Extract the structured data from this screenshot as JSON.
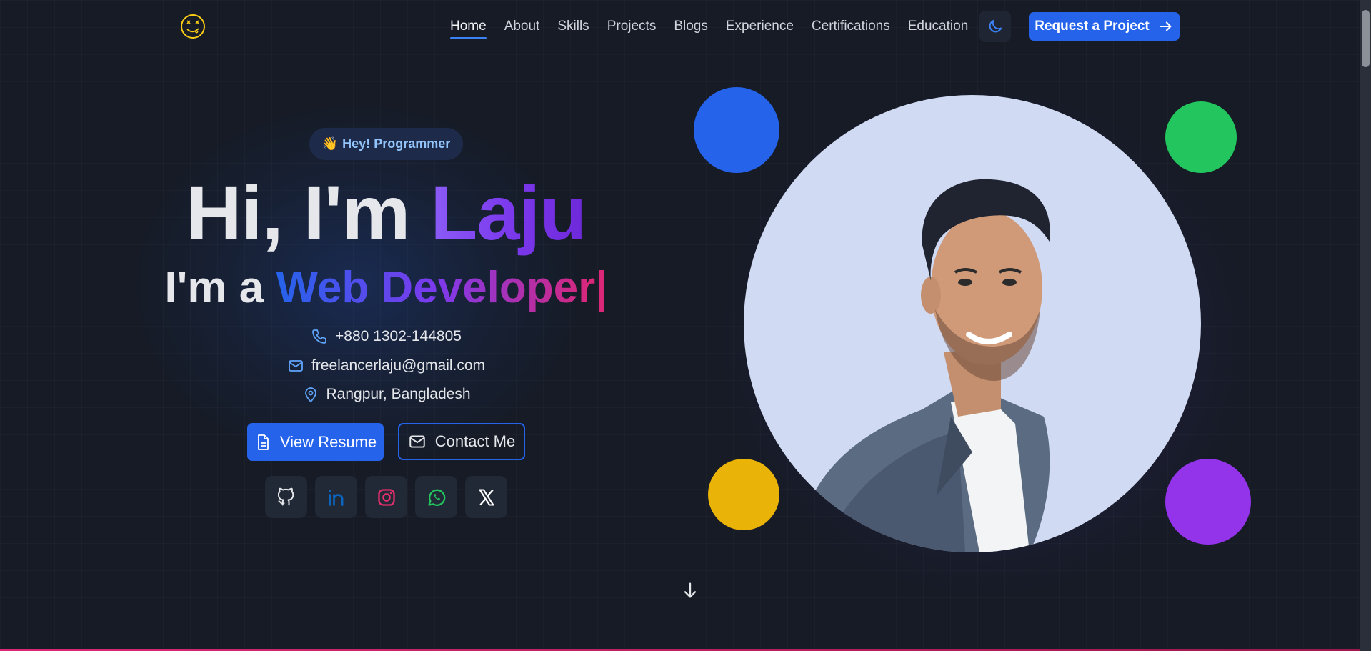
{
  "nav": {
    "logo_icon": "smiley-face-logo-icon",
    "items": [
      {
        "label": "Home",
        "active": true
      },
      {
        "label": "About"
      },
      {
        "label": "Skills"
      },
      {
        "label": "Projects"
      },
      {
        "label": "Blogs"
      },
      {
        "label": "Experience"
      },
      {
        "label": "Certifications"
      },
      {
        "label": "Education"
      }
    ],
    "theme_toggle_icon": "moon-icon",
    "cta_label": "Request a Project",
    "cta_icon": "arrow-right-icon"
  },
  "hero": {
    "badge_emoji": "👋",
    "badge_label": "Hey! Programmer",
    "title_prefix": "Hi, I'm ",
    "title_name": "Laju",
    "subtitle_prefix": "I'm a ",
    "subtitle_role": "Web Developer",
    "subtitle_cursor": "|",
    "phone": "+880 1302-144805",
    "email": "freelancerlaju@gmail.com",
    "location": "Rangpur, Bangladesh",
    "resume_label": "View Resume",
    "contact_label": "Contact Me",
    "socials": [
      {
        "name": "github-icon",
        "color": "#e5e7eb"
      },
      {
        "name": "linkedin-icon",
        "color": "#0a66c2"
      },
      {
        "name": "instagram-icon",
        "color": "#e1306c"
      },
      {
        "name": "whatsapp-icon",
        "color": "#22c55e"
      },
      {
        "name": "x-twitter-icon",
        "color": "#ffffff"
      }
    ]
  },
  "colors": {
    "accent": "#2563eb",
    "dot_blue": "#2563eb",
    "dot_green": "#22c55e",
    "dot_yellow": "#eab308",
    "dot_purple": "#9333ea",
    "background": "#161b26"
  }
}
